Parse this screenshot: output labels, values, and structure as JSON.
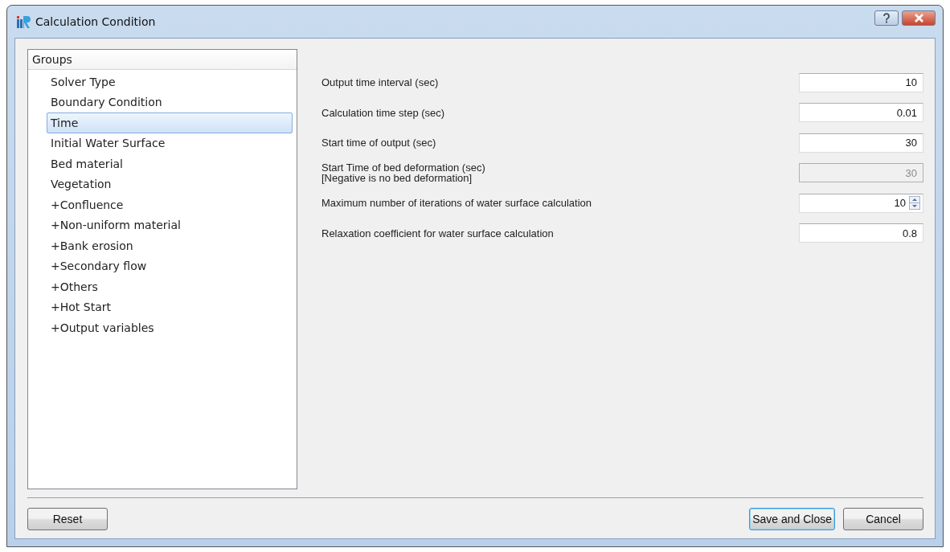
{
  "window": {
    "title": "Calculation Condition"
  },
  "groups": {
    "header": "Groups",
    "items": [
      {
        "label": "Solver Type",
        "selected": false
      },
      {
        "label": "Boundary Condition",
        "selected": false
      },
      {
        "label": "Time",
        "selected": true
      },
      {
        "label": "Initial Water Surface",
        "selected": false
      },
      {
        "label": "Bed material",
        "selected": false
      },
      {
        "label": "Vegetation",
        "selected": false
      },
      {
        "label": "+Confluence",
        "selected": false
      },
      {
        "label": "+Non-uniform material",
        "selected": false
      },
      {
        "label": "+Bank erosion",
        "selected": false
      },
      {
        "label": "+Secondary flow",
        "selected": false
      },
      {
        "label": "+Others",
        "selected": false
      },
      {
        "label": "+Hot Start",
        "selected": false
      },
      {
        "label": "+Output variables",
        "selected": false
      }
    ]
  },
  "fields": [
    {
      "kind": "text",
      "label": "Output time interval (sec)",
      "value": "10",
      "disabled": false
    },
    {
      "kind": "text",
      "label": "Calculation time step (sec)",
      "value": "0.01",
      "disabled": false
    },
    {
      "kind": "text",
      "label": "Start time of output (sec)",
      "value": "30",
      "disabled": false
    },
    {
      "kind": "text",
      "label": "Start Time of bed deformation (sec)",
      "note": "[Negative is no bed deformation]",
      "value": "30",
      "disabled": true
    },
    {
      "kind": "spin",
      "label": "Maximum number of iterations of water surface calculation",
      "value": "10",
      "disabled": false
    },
    {
      "kind": "text",
      "label": "Relaxation coefficient for water surface calculation",
      "value": "0.8",
      "disabled": false
    }
  ],
  "buttons": {
    "left": [
      "Reset"
    ],
    "right": [
      {
        "label": "Save and Close",
        "selected": true
      },
      {
        "label": "Cancel",
        "selected": false
      }
    ]
  }
}
